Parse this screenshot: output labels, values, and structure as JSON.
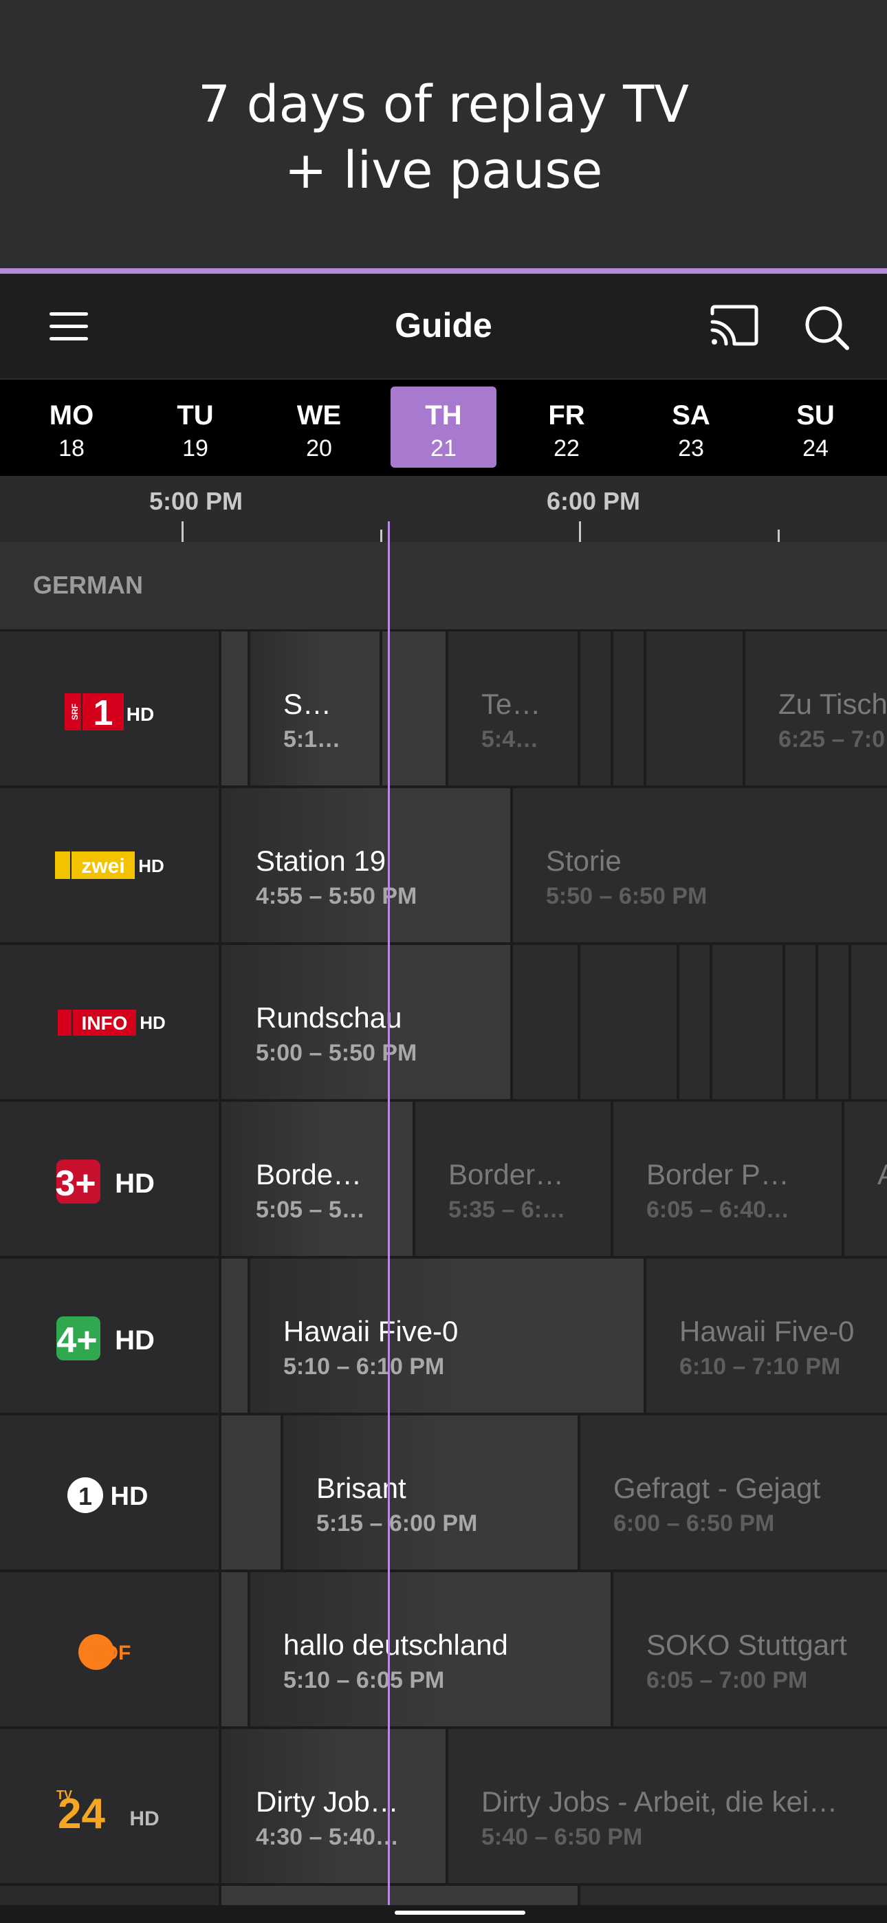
{
  "promo": {
    "line1": "7 days of replay TV",
    "line2": "+ live pause"
  },
  "header": {
    "title": "Guide",
    "icons": [
      "menu-icon",
      "cast-icon",
      "search-icon"
    ]
  },
  "days": [
    {
      "name": "MO",
      "num": "18",
      "selected": false
    },
    {
      "name": "TU",
      "num": "19",
      "selected": false
    },
    {
      "name": "WE",
      "num": "20",
      "selected": false
    },
    {
      "name": "TH",
      "num": "21",
      "selected": true
    },
    {
      "name": "FR",
      "num": "22",
      "selected": false
    },
    {
      "name": "SA",
      "num": "23",
      "selected": false
    },
    {
      "name": "SU",
      "num": "24",
      "selected": false
    }
  ],
  "timeline": {
    "labels": [
      "5:00 PM",
      "6:00 PM"
    ]
  },
  "group": {
    "label": "GERMAN"
  },
  "channels": [
    {
      "logo": "SRF 1 HD",
      "programs": [
        {
          "title": "S…",
          "time": "5:1…"
        },
        {
          "title": "Te…",
          "time": "5:4…"
        },
        {
          "title": "Zu Tisch",
          "time": "6:25 – 7:0"
        }
      ]
    },
    {
      "logo": "SRF zwei HD",
      "programs": [
        {
          "title": "Station 19",
          "time": "4:55 – 5:50 PM"
        },
        {
          "title": "Storie",
          "time": "5:50 – 6:50 PM"
        }
      ]
    },
    {
      "logo": "SRF info HD",
      "programs": [
        {
          "title": "Rundschau",
          "time": "5:00 – 5:50 PM"
        }
      ]
    },
    {
      "logo": "3+ HD",
      "programs": [
        {
          "title": "Borde…",
          "time": "5:05 – 5…"
        },
        {
          "title": "Border…",
          "time": "5:35 – 6:…"
        },
        {
          "title": "Border P…",
          "time": "6:05 – 6:40…"
        },
        {
          "title": "A",
          "time": ""
        }
      ]
    },
    {
      "logo": "4+ HD",
      "programs": [
        {
          "title": "Hawaii Five-0",
          "time": "5:10 – 6:10 PM"
        },
        {
          "title": "Hawaii Five-0",
          "time": "6:10 – 7:10 PM"
        }
      ]
    },
    {
      "logo": "1 HD",
      "programs": [
        {
          "title": "Brisant",
          "time": "5:15 – 6:00 PM"
        },
        {
          "title": "Gefragt - Gejagt",
          "time": "6:00 – 6:50 PM"
        }
      ]
    },
    {
      "logo": "2DF",
      "programs": [
        {
          "title": "hallo deutschland",
          "time": "5:10 – 6:05 PM"
        },
        {
          "title": "SOKO Stuttgart",
          "time": "6:05 – 7:00 PM"
        }
      ]
    },
    {
      "logo": "TV24 HD",
      "programs": [
        {
          "title": "Dirty Job…",
          "time": "4:30 – 5:40…"
        },
        {
          "title": "Dirty Jobs - Arbeit, die kei…",
          "time": "5:40 – 6:50 PM"
        }
      ]
    }
  ],
  "colors": {
    "accent": "#a77ad0",
    "now_line": "#b58de0",
    "background": "#2b2b2d"
  }
}
